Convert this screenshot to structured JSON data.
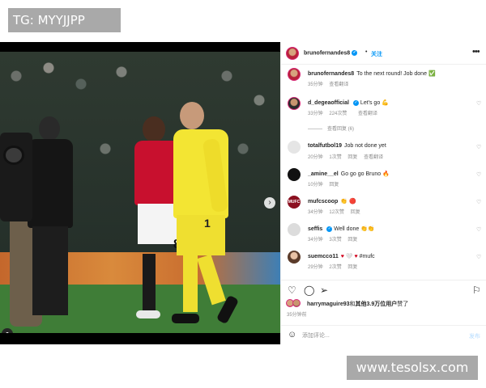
{
  "watermarks": {
    "top_left": "TG: MYYJJPP",
    "bottom_right": "www.tesolsx.com"
  },
  "photo": {
    "gk_number": "1",
    "player_number": "8",
    "carousel_total": 4,
    "carousel_active": 1
  },
  "header": {
    "username": "brunofernandes8",
    "follow_label": "关注",
    "separator": "•",
    "avatar_icon": "profile-avatar",
    "more_icon": "more-horizontal-icon"
  },
  "caption": {
    "username": "brunofernandes8",
    "text": "To the next round! Job done",
    "emoji": "✅",
    "time": "35分钟",
    "translate": "查看翻译"
  },
  "comments": [
    {
      "username": "d_degeaofficial",
      "verified": true,
      "text": "Let's go",
      "emoji": "💪",
      "time": "33分钟",
      "likes": "224次赞",
      "reply": "",
      "translate": "查看翻译",
      "view_replies": "查看回复 (6)"
    },
    {
      "username": "totalfutbol19",
      "verified": false,
      "text": "Job not done yet",
      "emoji": "",
      "time": "20分钟",
      "likes": "1次赞",
      "reply": "回复",
      "translate": "查看翻译"
    },
    {
      "username": "_amine__el",
      "verified": false,
      "text": "Go go go Bruno",
      "emoji": "🔥",
      "time": "10分钟",
      "likes": "",
      "reply": "回复",
      "translate": ""
    },
    {
      "username": "mufcscoop",
      "verified": false,
      "text": "",
      "emoji": "👏 🔴",
      "time": "34分钟",
      "likes": "12次赞",
      "reply": "回复",
      "translate": ""
    },
    {
      "username": "seffis",
      "verified": true,
      "text": "Well done",
      "emoji": "👏👏",
      "time": "34分钟",
      "likes": "3次赞",
      "reply": "回复",
      "translate": ""
    },
    {
      "username": "suemcco11",
      "verified": false,
      "text": "#mufc",
      "emoji": "♥ 🤍 ♥",
      "time": "29分钟",
      "likes": "2次赞",
      "reply": "回复",
      "translate": ""
    }
  ],
  "actions": {
    "like_icon": "heart-icon",
    "comment_icon": "comment-icon",
    "share_icon": "share-icon",
    "save_icon": "bookmark-icon"
  },
  "likes": {
    "user": "harrymaguire93",
    "middle": "和",
    "count_text": "其他3.9万位用户",
    "suffix": "赞了"
  },
  "post_time": "35分钟前",
  "add_comment": {
    "placeholder": "添加评论...",
    "post_label": "发布"
  },
  "colors": {
    "accent": "#0095f6",
    "muted": "#8e8e8e",
    "jersey_red": "#c8102e",
    "gk_yellow": "#f3e533"
  }
}
